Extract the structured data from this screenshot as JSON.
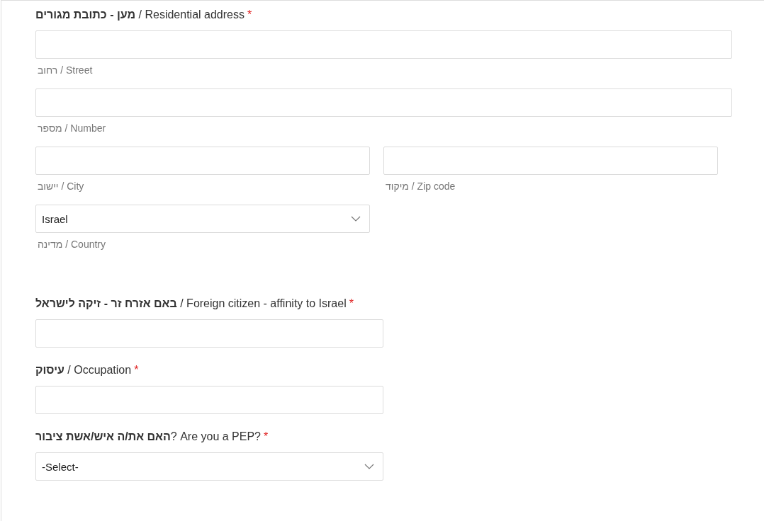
{
  "address": {
    "label": "**מען - כתובת מגורים** / Residential address",
    "required_mark": "*",
    "street": {
      "kind": "text",
      "sublabel": "רחוב / Street"
    },
    "number": {
      "kind": "text",
      "sublabel": "מספר / Number"
    },
    "city": {
      "kind": "text",
      "sublabel": "יישוב / City"
    },
    "zip": {
      "kind": "text",
      "sublabel": "מיקוד / Zip code"
    },
    "country": {
      "kind": "select",
      "value": "Israel",
      "sublabel": "מדינה / Country"
    }
  },
  "questions": [
    {
      "label": "**באם אזרח זר - זיקה לישראל** / Foreign citizen - affinity to Israel",
      "required_mark": "*",
      "kind": "text"
    },
    {
      "label": "**עיסוק** / Occupation",
      "required_mark": "*",
      "kind": "text"
    },
    {
      "label": "**האם את/ה איש/אשת ציבור**? Are you a PEP?",
      "required_mark": "*",
      "kind": "select",
      "value": "-Select-"
    }
  ]
}
